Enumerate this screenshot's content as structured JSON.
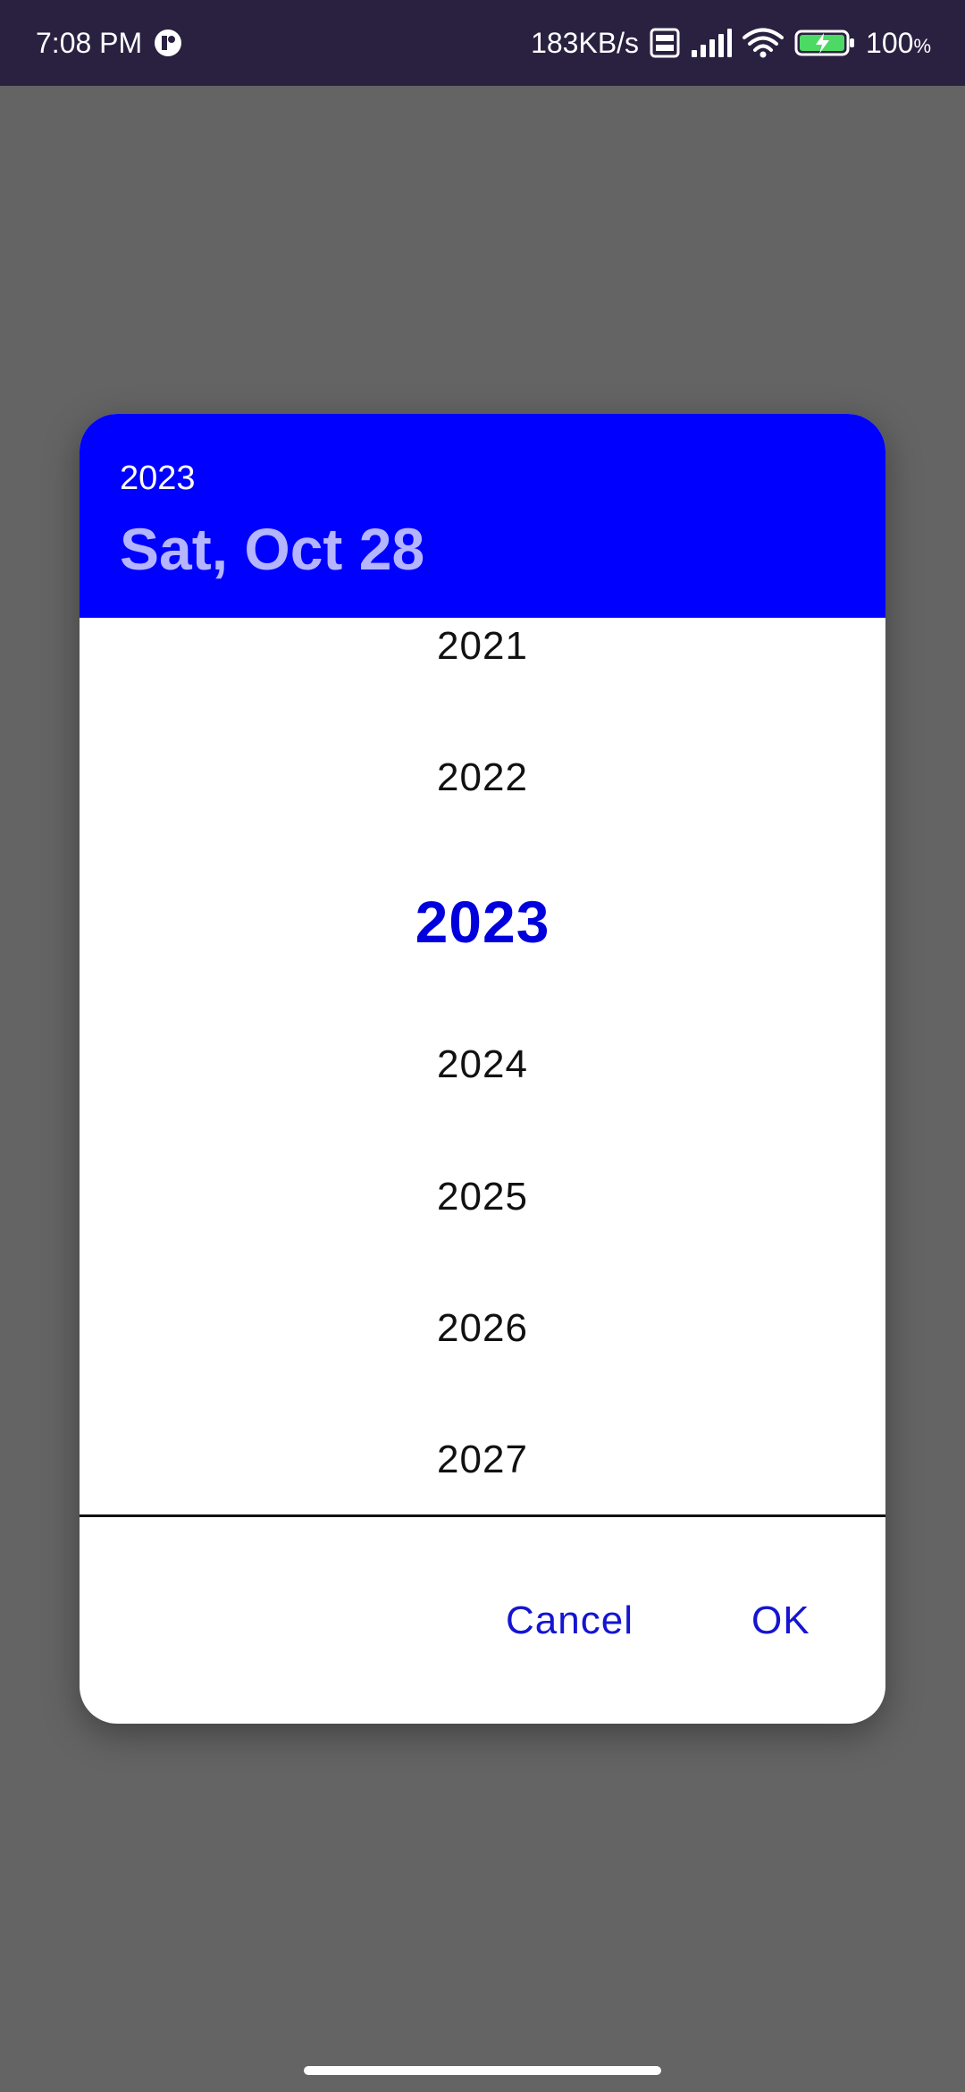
{
  "status_bar": {
    "time": "7:08 PM",
    "network_speed": "183KB/s",
    "battery_percent": "100",
    "battery_unit": "%",
    "icons": [
      "app-notification-icon",
      "volte-icon",
      "signal-icon",
      "wifi-icon",
      "battery-charging-icon"
    ]
  },
  "dialog": {
    "header": {
      "year": "2023",
      "date": "Sat, Oct 28",
      "background_color": "#0000ff"
    },
    "years": [
      {
        "label": "2021",
        "selected": false
      },
      {
        "label": "2022",
        "selected": false
      },
      {
        "label": "2023",
        "selected": true
      },
      {
        "label": "2024",
        "selected": false
      },
      {
        "label": "2025",
        "selected": false
      },
      {
        "label": "2026",
        "selected": false
      },
      {
        "label": "2027",
        "selected": false
      }
    ],
    "actions": {
      "cancel_label": "Cancel",
      "ok_label": "OK"
    },
    "accent_color": "#1414d2"
  }
}
